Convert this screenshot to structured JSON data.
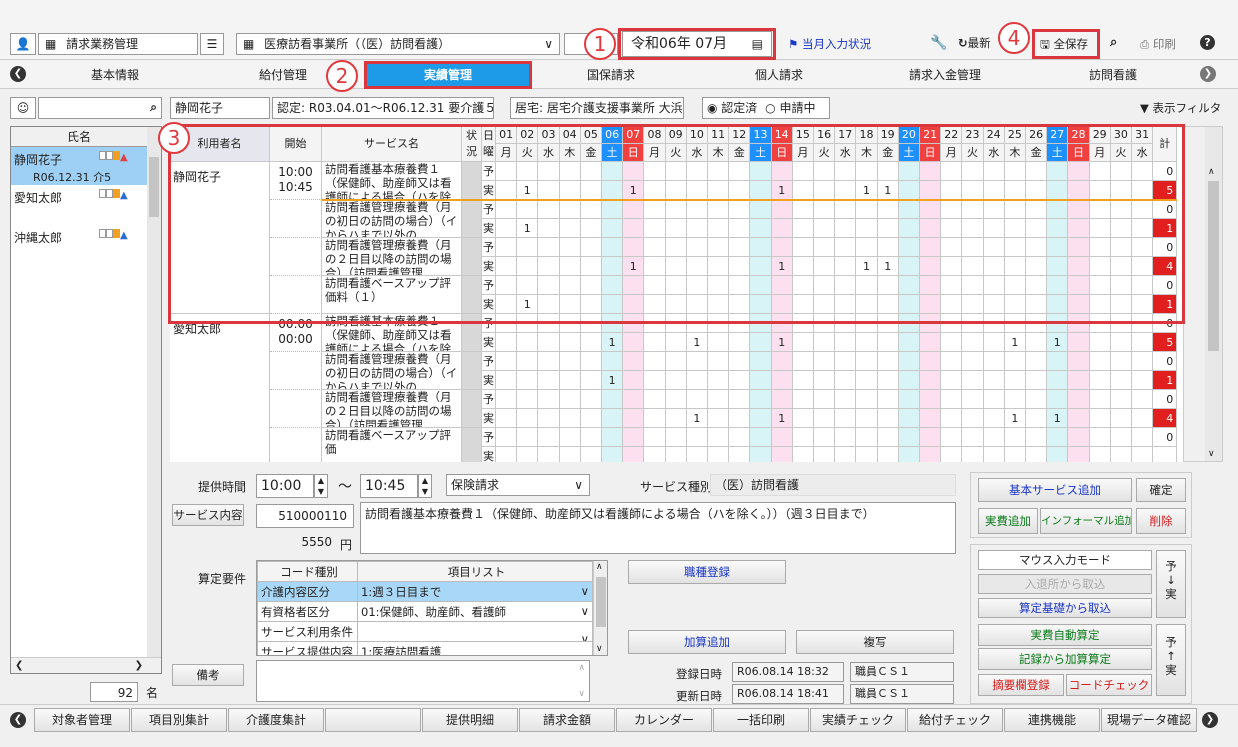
{
  "toolbar": {
    "app_name": "請求業務管理",
    "office": "医療訪看事業所（（医）訪問看護）",
    "date": "令和06年 07月",
    "monthly_status": "当月入力状況",
    "refresh": "最新",
    "save_all": "全保存",
    "print": "印刷"
  },
  "tabs": [
    "基本情報",
    "給付管理",
    "実績管理",
    "国保請求",
    "個人請求",
    "請求入金管理",
    "訪問看護"
  ],
  "active_tab": "実績管理",
  "filter": {
    "patient": "静岡花子",
    "certification": "認定: R03.04.01～R06.12.31 要介護５",
    "home": "居宅: 居宅介護支援事業所 大浜",
    "radio1": "認定済",
    "radio2": "申請中",
    "display_filter": "表示フィルタ"
  },
  "patient_list": {
    "header": "氏名",
    "items": [
      {
        "name": "静岡花子",
        "sub": "R06.12.31 介5"
      },
      {
        "name": "愛知太郎",
        "sub": ""
      },
      {
        "name": "沖縄太郎",
        "sub": ""
      }
    ],
    "count": "92",
    "count_unit": "名"
  },
  "grid": {
    "headers": {
      "user": "利用者名",
      "start": "開始",
      "service": "サービス名",
      "status": "状況",
      "day": "日曜",
      "total": "計"
    },
    "days": [
      {
        "d": "01",
        "w": "月"
      },
      {
        "d": "02",
        "w": "火"
      },
      {
        "d": "03",
        "w": "水"
      },
      {
        "d": "04",
        "w": "木"
      },
      {
        "d": "05",
        "w": "金"
      },
      {
        "d": "06",
        "w": "土"
      },
      {
        "d": "07",
        "w": "日"
      },
      {
        "d": "08",
        "w": "月"
      },
      {
        "d": "09",
        "w": "火"
      },
      {
        "d": "10",
        "w": "水"
      },
      {
        "d": "11",
        "w": "木"
      },
      {
        "d": "12",
        "w": "金"
      },
      {
        "d": "13",
        "w": "土"
      },
      {
        "d": "14",
        "w": "日"
      },
      {
        "d": "15",
        "w": "月"
      },
      {
        "d": "16",
        "w": "火"
      },
      {
        "d": "17",
        "w": "水"
      },
      {
        "d": "18",
        "w": "木"
      },
      {
        "d": "19",
        "w": "金"
      },
      {
        "d": "20",
        "w": "土"
      },
      {
        "d": "21",
        "w": "日"
      },
      {
        "d": "22",
        "w": "月"
      },
      {
        "d": "23",
        "w": "火"
      },
      {
        "d": "24",
        "w": "水"
      },
      {
        "d": "25",
        "w": "木"
      },
      {
        "d": "26",
        "w": "金"
      },
      {
        "d": "27",
        "w": "土"
      },
      {
        "d": "28",
        "w": "日"
      },
      {
        "d": "29",
        "w": "月"
      },
      {
        "d": "30",
        "w": "火"
      },
      {
        "d": "31",
        "w": "水"
      }
    ],
    "plan_label": "予",
    "actual_label": "実",
    "blocks": [
      {
        "name": "静岡花子",
        "start": "10:00",
        "end": "10:45",
        "services": [
          {
            "text": "訪問看護基本療養費１（保健師、助産師又は看護師による場合（ハを除く",
            "plan_total": "0",
            "actual_total": "5",
            "actual_days": [
              2,
              7,
              14,
              18,
              19
            ]
          },
          {
            "text": "訪問看護管理療養費（月の初日の訪問の場合）（イからハまで以外の",
            "plan_total": "0",
            "actual_total": "1",
            "actual_days": [
              2
            ]
          },
          {
            "text": "訪問看護管理療養費（月の２日目以降の訪問の場合）（訪問看護管理",
            "plan_total": "0",
            "actual_total": "4",
            "actual_days": [
              7,
              14,
              18,
              19
            ]
          },
          {
            "text": "訪問看護ベースアップ評価料（１）",
            "plan_total": "0",
            "actual_total": "1",
            "actual_days": [
              2
            ]
          }
        ]
      },
      {
        "name": "愛知太郎",
        "start": "00:00",
        "end": "00:00",
        "services": [
          {
            "text": "訪問看護基本療養費１（保健師、助産師又は看護師による場合（ハを除く",
            "plan_total": "0",
            "actual_total": "5",
            "actual_days": [
              6,
              10,
              14,
              25,
              27
            ]
          },
          {
            "text": "訪問看護管理療養費（月の初日の訪問の場合）（イからハまで以外の",
            "plan_total": "0",
            "actual_total": "1",
            "actual_days": [
              6
            ]
          },
          {
            "text": "訪問看護管理療養費（月の２日目以降の訪問の場合）（訪問看護管理",
            "plan_total": "0",
            "actual_total": "4",
            "actual_days": [
              10,
              14,
              25,
              27
            ]
          },
          {
            "text": "訪問看護ベースアップ評価",
            "plan_total": "0",
            "actual_total": "",
            "actual_days": []
          }
        ]
      }
    ]
  },
  "detail": {
    "time_label": "提供時間",
    "time_from": "10:00",
    "tilde": "～",
    "time_to": "10:45",
    "billing": "保険請求",
    "service_type_label": "サービス種別",
    "service_type": "（医）訪問看護",
    "service_content_btn": "サービス内容",
    "code": "510000110",
    "service_desc": "訪問看護基本療養費１（保健師、助産師又は看護師による場合（ハを除く。））（週３日目まで）",
    "amount": "5550",
    "yen": "円",
    "calc_label": "算定要件",
    "req_headers": [
      "コード種別",
      "項目リスト"
    ],
    "requirements": [
      {
        "type": "介護内容区分",
        "value": "1:週３日目まで"
      },
      {
        "type": "有資格者区分",
        "value": "01:保健師、助産師、看護師"
      },
      {
        "type": "サービス利用条件",
        "value": ""
      },
      {
        "type": "サービス提供内容",
        "value": "1:医療訪問看護"
      }
    ],
    "staff_btn": "職種登録",
    "add_btn": "加算追加",
    "copy_btn": "複写",
    "note_label": "備考",
    "reg_label": "登録日時",
    "reg_date": "R06.08.14 18:32",
    "reg_staff": "職員ＣＳ１",
    "upd_label": "更新日時",
    "upd_date": "R06.08.14 18:41",
    "upd_staff": "職員ＣＳ１"
  },
  "right_panel": {
    "basic_add": "基本サービス追加",
    "confirm": "確定",
    "actual_add": "実費追加",
    "informal_add": "インフォーマル追加",
    "delete": "削除",
    "mouse_mode": "マウス入力モード",
    "import_exit": "入退所から取込",
    "import_base": "算定基礎から取込",
    "auto_calc": "実費自動算定",
    "record_calc": "記録から加算算定",
    "summary_reg": "摘要欄登録",
    "code_check": "コードチェック",
    "plan_to_actual_top": "予",
    "plan_to_actual_bottom": "実",
    "actual_to_plan_top": "予",
    "actual_to_plan_bottom": "実"
  },
  "bottom_buttons": [
    "対象者管理",
    "項目別集計",
    "介護度集計",
    "",
    "提供明細",
    "請求金額",
    "カレンダー",
    "一括印刷",
    "実績チェック",
    "給付チェック",
    "連携機能",
    "現場データ確認"
  ],
  "annotations": [
    "1",
    "2",
    "3",
    "4"
  ],
  "colors": {
    "saturday": "#1e90ff",
    "sunday": "#f04040",
    "sat_col": "#d8f4f6",
    "sun_col": "#fde0ef",
    "total_red": "#e21f1f",
    "active_tab": "#1e9be8"
  }
}
